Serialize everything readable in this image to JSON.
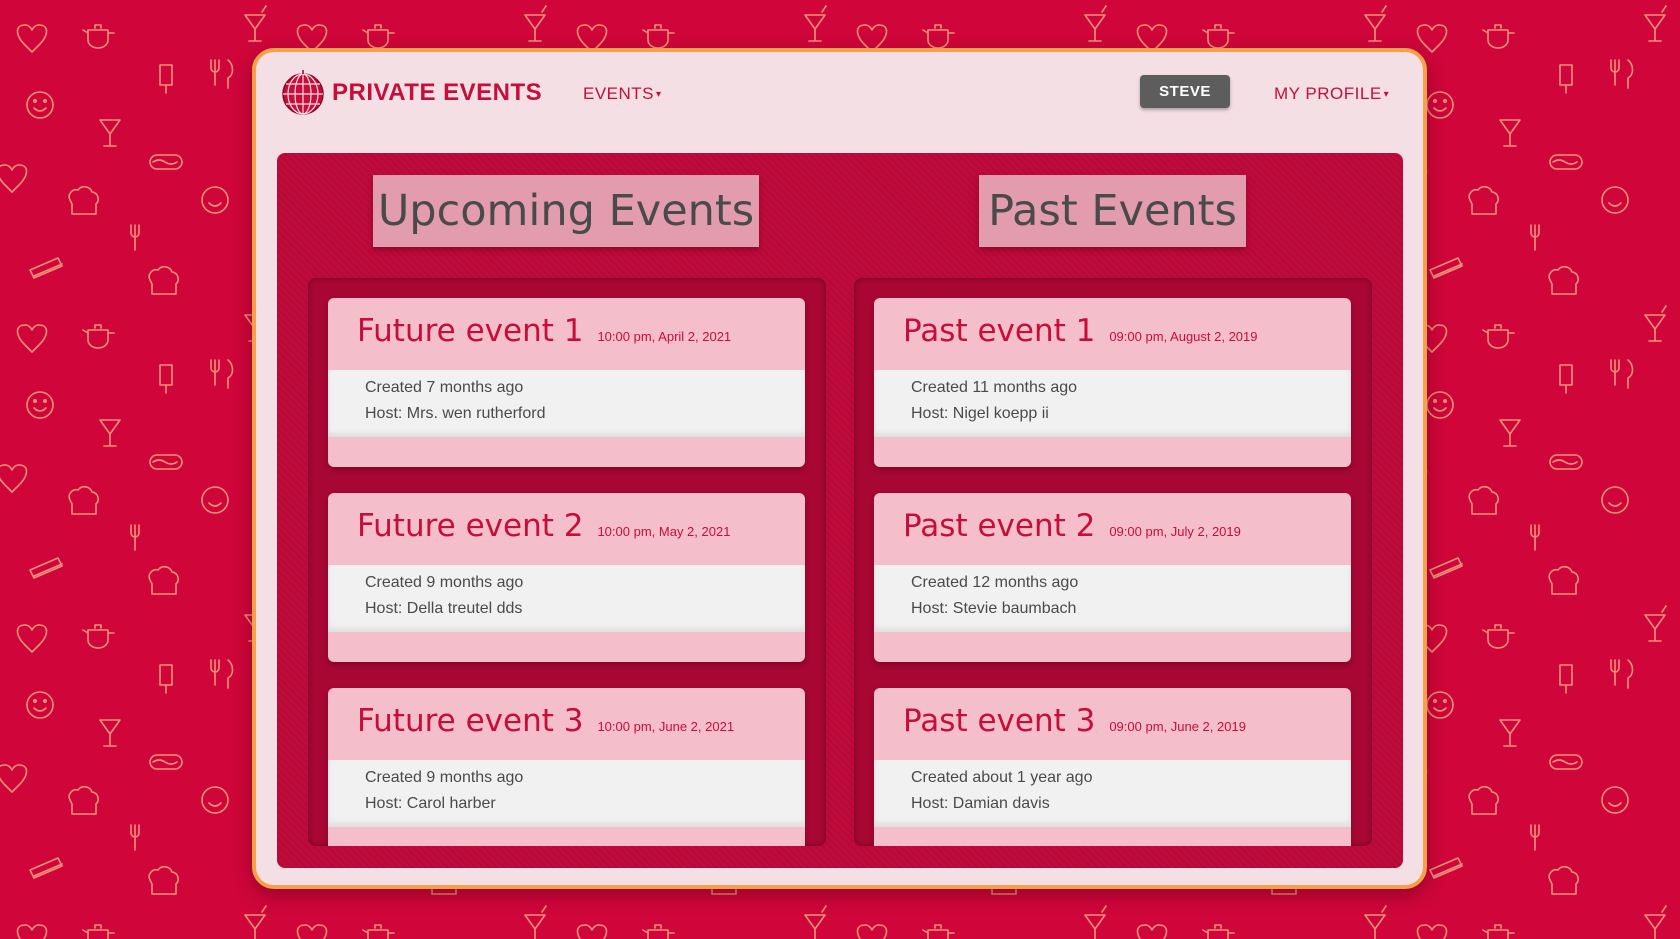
{
  "brand": {
    "name": "PRIVATE EVENTS"
  },
  "nav": {
    "events_label": "EVENTS",
    "user_button": "STEVE",
    "profile_label": "MY PROFILE"
  },
  "sections": {
    "upcoming_title": "Upcoming Events",
    "past_title": "Past Events"
  },
  "upcoming_events": [
    {
      "title": "Future event 1",
      "date": "10:00 pm, April 2, 2021",
      "created": "Created 7 months ago",
      "host": "Host: Mrs. wen rutherford"
    },
    {
      "title": "Future event 2",
      "date": "10:00 pm, May 2, 2021",
      "created": "Created 9 months ago",
      "host": "Host: Della treutel dds"
    },
    {
      "title": "Future event 3",
      "date": "10:00 pm, June 2, 2021",
      "created": "Created 9 months ago",
      "host": "Host: Carol harber"
    }
  ],
  "past_events": [
    {
      "title": "Past event 1",
      "date": "09:00 pm, August 2, 2019",
      "created": "Created 11 months ago",
      "host": "Host: Nigel koepp ii"
    },
    {
      "title": "Past event 2",
      "date": "09:00 pm, July 2, 2019",
      "created": "Created 12 months ago",
      "host": "Host: Stevie baumbach"
    },
    {
      "title": "Past event 3",
      "date": "09:00 pm, June 2, 2019",
      "created": "Created about 1 year ago",
      "host": "Host: Damian davis"
    }
  ],
  "colors": {
    "background": "#d0063a",
    "accent": "#c70d3a",
    "window_border": "#f6a14a",
    "card": "#f4bfcb"
  }
}
